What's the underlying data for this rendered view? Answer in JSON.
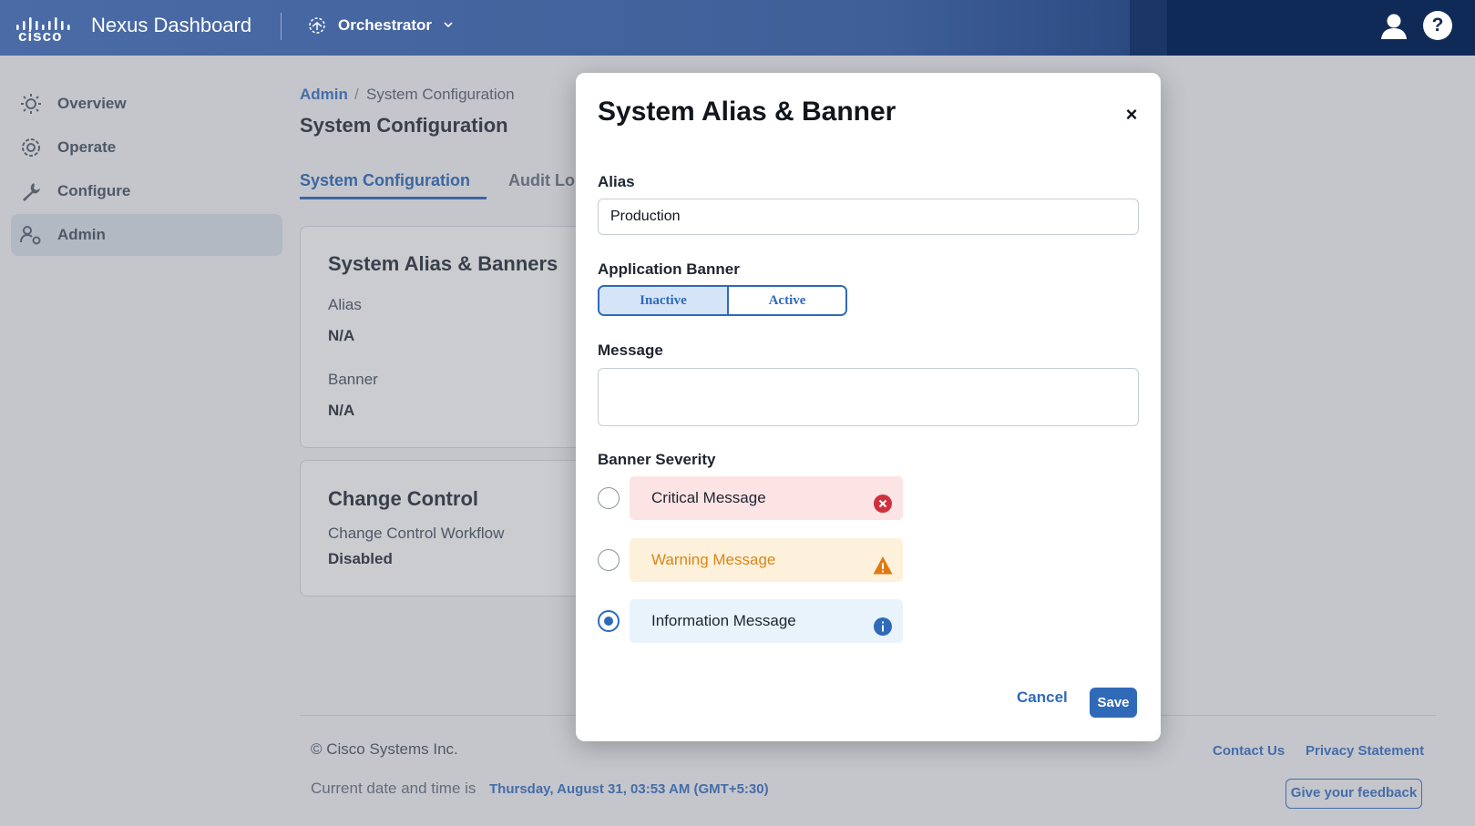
{
  "header": {
    "brand_word": "cisco",
    "app_title": "Nexus Dashboard",
    "service": "Orchestrator"
  },
  "sidebar": {
    "items": [
      {
        "label": "Overview",
        "icon": "sun-icon"
      },
      {
        "label": "Operate",
        "icon": "gear-target-icon"
      },
      {
        "label": "Configure",
        "icon": "wrench-icon"
      },
      {
        "label": "Admin",
        "icon": "user-gear-icon",
        "active": true
      }
    ]
  },
  "breadcrumb": {
    "root": "Admin",
    "separator": "/",
    "current": "System Configuration"
  },
  "page": {
    "title": "System Configuration",
    "tabs": [
      "System Configuration",
      "Audit Lo"
    ]
  },
  "cards": {
    "alias_banners": {
      "title": "System Alias & Banners",
      "alias_label": "Alias",
      "alias_value": "N/A",
      "banner_label": "Banner",
      "banner_value": "N/A"
    },
    "change_control": {
      "title": "Change Control",
      "workflow_label": "Change Control Workflow",
      "workflow_value": "Disabled"
    }
  },
  "footer": {
    "copyright": "© Cisco Systems Inc.",
    "date_label": "Current date and time is",
    "date_value": "Thursday, August 31, 03:53 AM (GMT+5:30)",
    "contact": "Contact Us",
    "privacy": "Privacy Statement",
    "feedback": "Give your feedback"
  },
  "modal": {
    "title": "System Alias & Banner",
    "close": "×",
    "alias_label": "Alias",
    "alias_value": "Production",
    "banner_label": "Application Banner",
    "banner_options": [
      "Inactive",
      "Active"
    ],
    "banner_selected": "Inactive",
    "message_label": "Message",
    "message_value": "",
    "severity_label": "Banner Severity",
    "severities": [
      {
        "label": "Critical Message",
        "icon": "error-icon",
        "color": "#d0303c",
        "checked": false
      },
      {
        "label": "Warning Message",
        "icon": "warning-icon",
        "color": "#e07a10",
        "checked": false
      },
      {
        "label": "Information Message",
        "icon": "info-icon",
        "color": "#2f6ab8",
        "checked": true
      }
    ],
    "cancel": "Cancel",
    "save": "Save"
  },
  "colors": {
    "accent": "#2f6ab8",
    "header": "#3f5f99"
  }
}
